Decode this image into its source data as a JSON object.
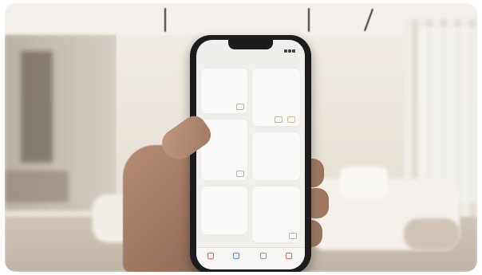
{
  "phone": {
    "status_time": "",
    "header_title": "",
    "tiles": [
      {
        "title": "",
        "subtitle": ""
      },
      {
        "title": "",
        "subtitle": ""
      },
      {
        "title": "",
        "subtitle": ""
      },
      {
        "title": "",
        "subtitle": ""
      },
      {
        "title": "",
        "subtitle": ""
      },
      {
        "title": "",
        "subtitle": ""
      }
    ],
    "tabs": [
      {
        "label": ""
      },
      {
        "label": ""
      },
      {
        "label": ""
      },
      {
        "label": ""
      }
    ]
  }
}
